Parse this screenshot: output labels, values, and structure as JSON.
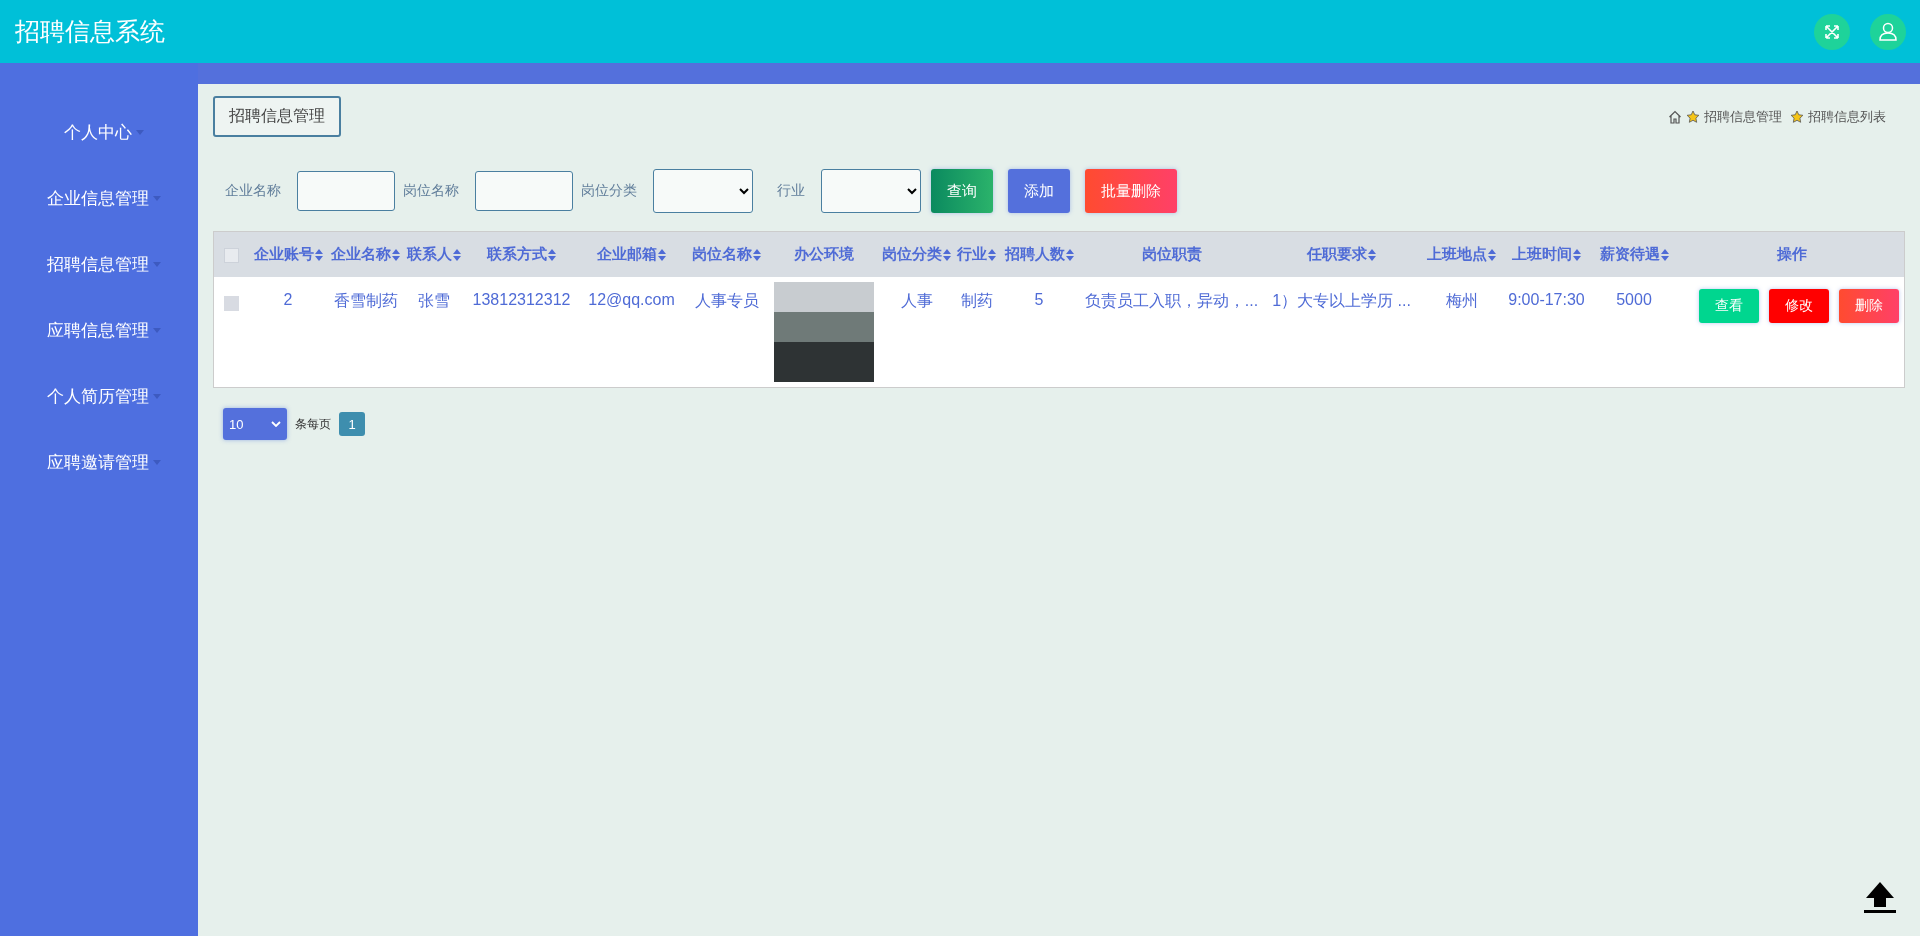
{
  "header": {
    "title": "招聘信息系统"
  },
  "sidebar": {
    "items": [
      {
        "label": "个人中心"
      },
      {
        "label": "企业信息管理"
      },
      {
        "label": "招聘信息管理"
      },
      {
        "label": "应聘信息管理"
      },
      {
        "label": "个人简历管理"
      },
      {
        "label": "应聘邀请管理"
      }
    ]
  },
  "page_title": "招聘信息管理",
  "breadcrumb": [
    "招聘信息管理",
    "招聘信息列表"
  ],
  "filters": [
    {
      "label": "企业名称",
      "kind": "text"
    },
    {
      "label": "岗位名称",
      "kind": "text"
    },
    {
      "label": "岗位分类",
      "kind": "select"
    },
    {
      "label": "行业",
      "kind": "select"
    }
  ],
  "buttons": [
    {
      "label": "查询",
      "kind": "query"
    },
    {
      "label": "添加",
      "kind": "add"
    },
    {
      "label": "批量删除",
      "kind": "danger"
    }
  ],
  "table": {
    "all_checked": false,
    "columns": [
      {
        "label": "企业账号",
        "sortable": true
      },
      {
        "label": "企业名称",
        "sortable": true
      },
      {
        "label": "联系人",
        "sortable": true
      },
      {
        "label": "联系方式",
        "sortable": true
      },
      {
        "label": "企业邮箱",
        "sortable": true
      },
      {
        "label": "岗位名称",
        "sortable": true
      },
      {
        "label": "办公环境",
        "sortable": false
      },
      {
        "label": "岗位分类",
        "sortable": true
      },
      {
        "label": "行业",
        "sortable": true
      },
      {
        "label": "招聘人数",
        "sortable": true
      },
      {
        "label": "岗位职责",
        "sortable": false
      },
      {
        "label": "任职要求",
        "sortable": true
      },
      {
        "label": "上班地点",
        "sortable": true
      },
      {
        "label": "上班时间",
        "sortable": true
      },
      {
        "label": "薪资待遇",
        "sortable": true
      },
      {
        "label": "操作",
        "sortable": false
      }
    ],
    "rows": [
      {
        "checked": false,
        "cells": [
          {
            "kind": "text",
            "text": "2"
          },
          {
            "kind": "text",
            "text": "香雪制药"
          },
          {
            "kind": "text",
            "text": "张雪"
          },
          {
            "kind": "text",
            "text": "13812312312"
          },
          {
            "kind": "text",
            "text": "12@qq.com"
          },
          {
            "kind": "text",
            "text": "人事专员"
          },
          {
            "kind": "photo"
          },
          {
            "kind": "text",
            "text": "人事"
          },
          {
            "kind": "text",
            "text": "制药"
          },
          {
            "kind": "text",
            "text": "5"
          },
          {
            "kind": "text",
            "text": "负责员工入职，异动，..."
          },
          {
            "kind": "text",
            "text": "1）大专以上学历 ..."
          },
          {
            "kind": "text",
            "text": "梅州"
          },
          {
            "kind": "text",
            "text": "9:00-17:30"
          },
          {
            "kind": "text",
            "text": "5000"
          }
        ],
        "actions": [
          {
            "label": "查看",
            "kind": "view"
          },
          {
            "label": "修改",
            "kind": "edit"
          },
          {
            "label": "删除",
            "kind": "danger"
          }
        ]
      }
    ]
  },
  "pagination": {
    "page_size": "10",
    "page_size_label": "条每页",
    "pages": [
      {
        "label": "1",
        "selected": true
      }
    ]
  }
}
